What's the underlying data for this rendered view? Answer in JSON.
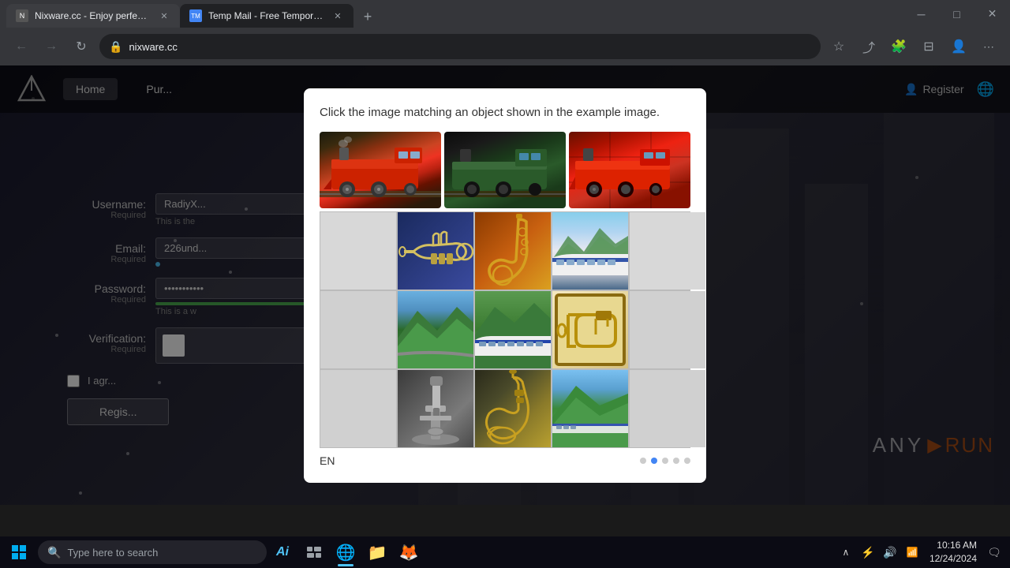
{
  "browser": {
    "tabs": [
      {
        "id": "tab1",
        "label": "Nixware.cc - Enjoy perfect perf...",
        "url": "nixware.cc",
        "active": false,
        "favicon": "N"
      },
      {
        "id": "tab2",
        "label": "Temp Mail - Free Temporary Disp...",
        "url": "",
        "active": true,
        "favicon": "TM"
      }
    ],
    "address": "nixware.cc",
    "window_controls": {
      "minimize": "─",
      "maximize": "□",
      "close": "✕"
    }
  },
  "site": {
    "logo": "△",
    "nav": [
      {
        "id": "home",
        "label": "Home",
        "active": true
      },
      {
        "id": "purchase",
        "label": "Pur..."
      }
    ],
    "header_right": {
      "register_icon": "👤",
      "register_label": "Register",
      "globe_icon": "🌐"
    }
  },
  "form": {
    "username_label": "Username:",
    "username_required": "Required",
    "username_value": "RadiyX...",
    "username_hint": "This is the",
    "email_label": "Email:",
    "email_required": "Required",
    "email_value": "226und...",
    "password_label": "Password:",
    "password_required": "Required",
    "password_value": "•••••••••",
    "password_hint": "This is a w",
    "verification_label": "Verification:",
    "verification_required": "Required",
    "agree_label": "I agr...",
    "register_button": "Regis..."
  },
  "captcha_modal": {
    "instruction": "Click the image matching an object shown in the example image.",
    "top_images": [
      {
        "id": "train1",
        "alt": "Red toy train locomotive left"
      },
      {
        "id": "train2",
        "alt": "Green/black train locomotive center"
      },
      {
        "id": "train3",
        "alt": "Red train locomotive right"
      }
    ],
    "grid_cells": [
      {
        "row": 0,
        "col": 0,
        "type": "empty"
      },
      {
        "row": 0,
        "col": 1,
        "type": "trumpet"
      },
      {
        "row": 0,
        "col": 2,
        "type": "saxophone"
      },
      {
        "row": 0,
        "col": 3,
        "type": "bullet-train"
      },
      {
        "row": 0,
        "col": 4,
        "type": "empty"
      },
      {
        "row": 1,
        "col": 0,
        "type": "empty"
      },
      {
        "row": 1,
        "col": 1,
        "type": "mountains"
      },
      {
        "row": 1,
        "col": 2,
        "type": "bullet-train-2"
      },
      {
        "row": 1,
        "col": 3,
        "type": "trombone"
      },
      {
        "row": 1,
        "col": 4,
        "type": "empty"
      },
      {
        "row": 2,
        "col": 0,
        "type": "empty"
      },
      {
        "row": 2,
        "col": 1,
        "type": "microscope"
      },
      {
        "row": 2,
        "col": 2,
        "type": "horn"
      },
      {
        "row": 2,
        "col": 3,
        "type": "valley-train"
      },
      {
        "row": 2,
        "col": 4,
        "type": "empty"
      }
    ],
    "bottom": {
      "language": "EN",
      "dots": [
        false,
        true,
        false,
        false,
        false
      ]
    }
  },
  "anyrun": {
    "text": "ANY",
    "suffix": "RUN"
  },
  "taskbar": {
    "search_placeholder": "Type here to search",
    "ai_label": "Ai",
    "apps": [
      {
        "id": "task-view",
        "icon": "⊞",
        "label": "Task View"
      },
      {
        "id": "edge",
        "icon": "e",
        "label": "Microsoft Edge",
        "active": true
      },
      {
        "id": "explorer",
        "icon": "📁",
        "label": "File Explorer"
      },
      {
        "id": "firefox",
        "icon": "🦊",
        "label": "Firefox"
      }
    ],
    "tray": {
      "icons": [
        "^",
        "⚡",
        "🔊",
        "📶"
      ],
      "time": "10:16 AM",
      "date": "12/24/2024"
    }
  }
}
